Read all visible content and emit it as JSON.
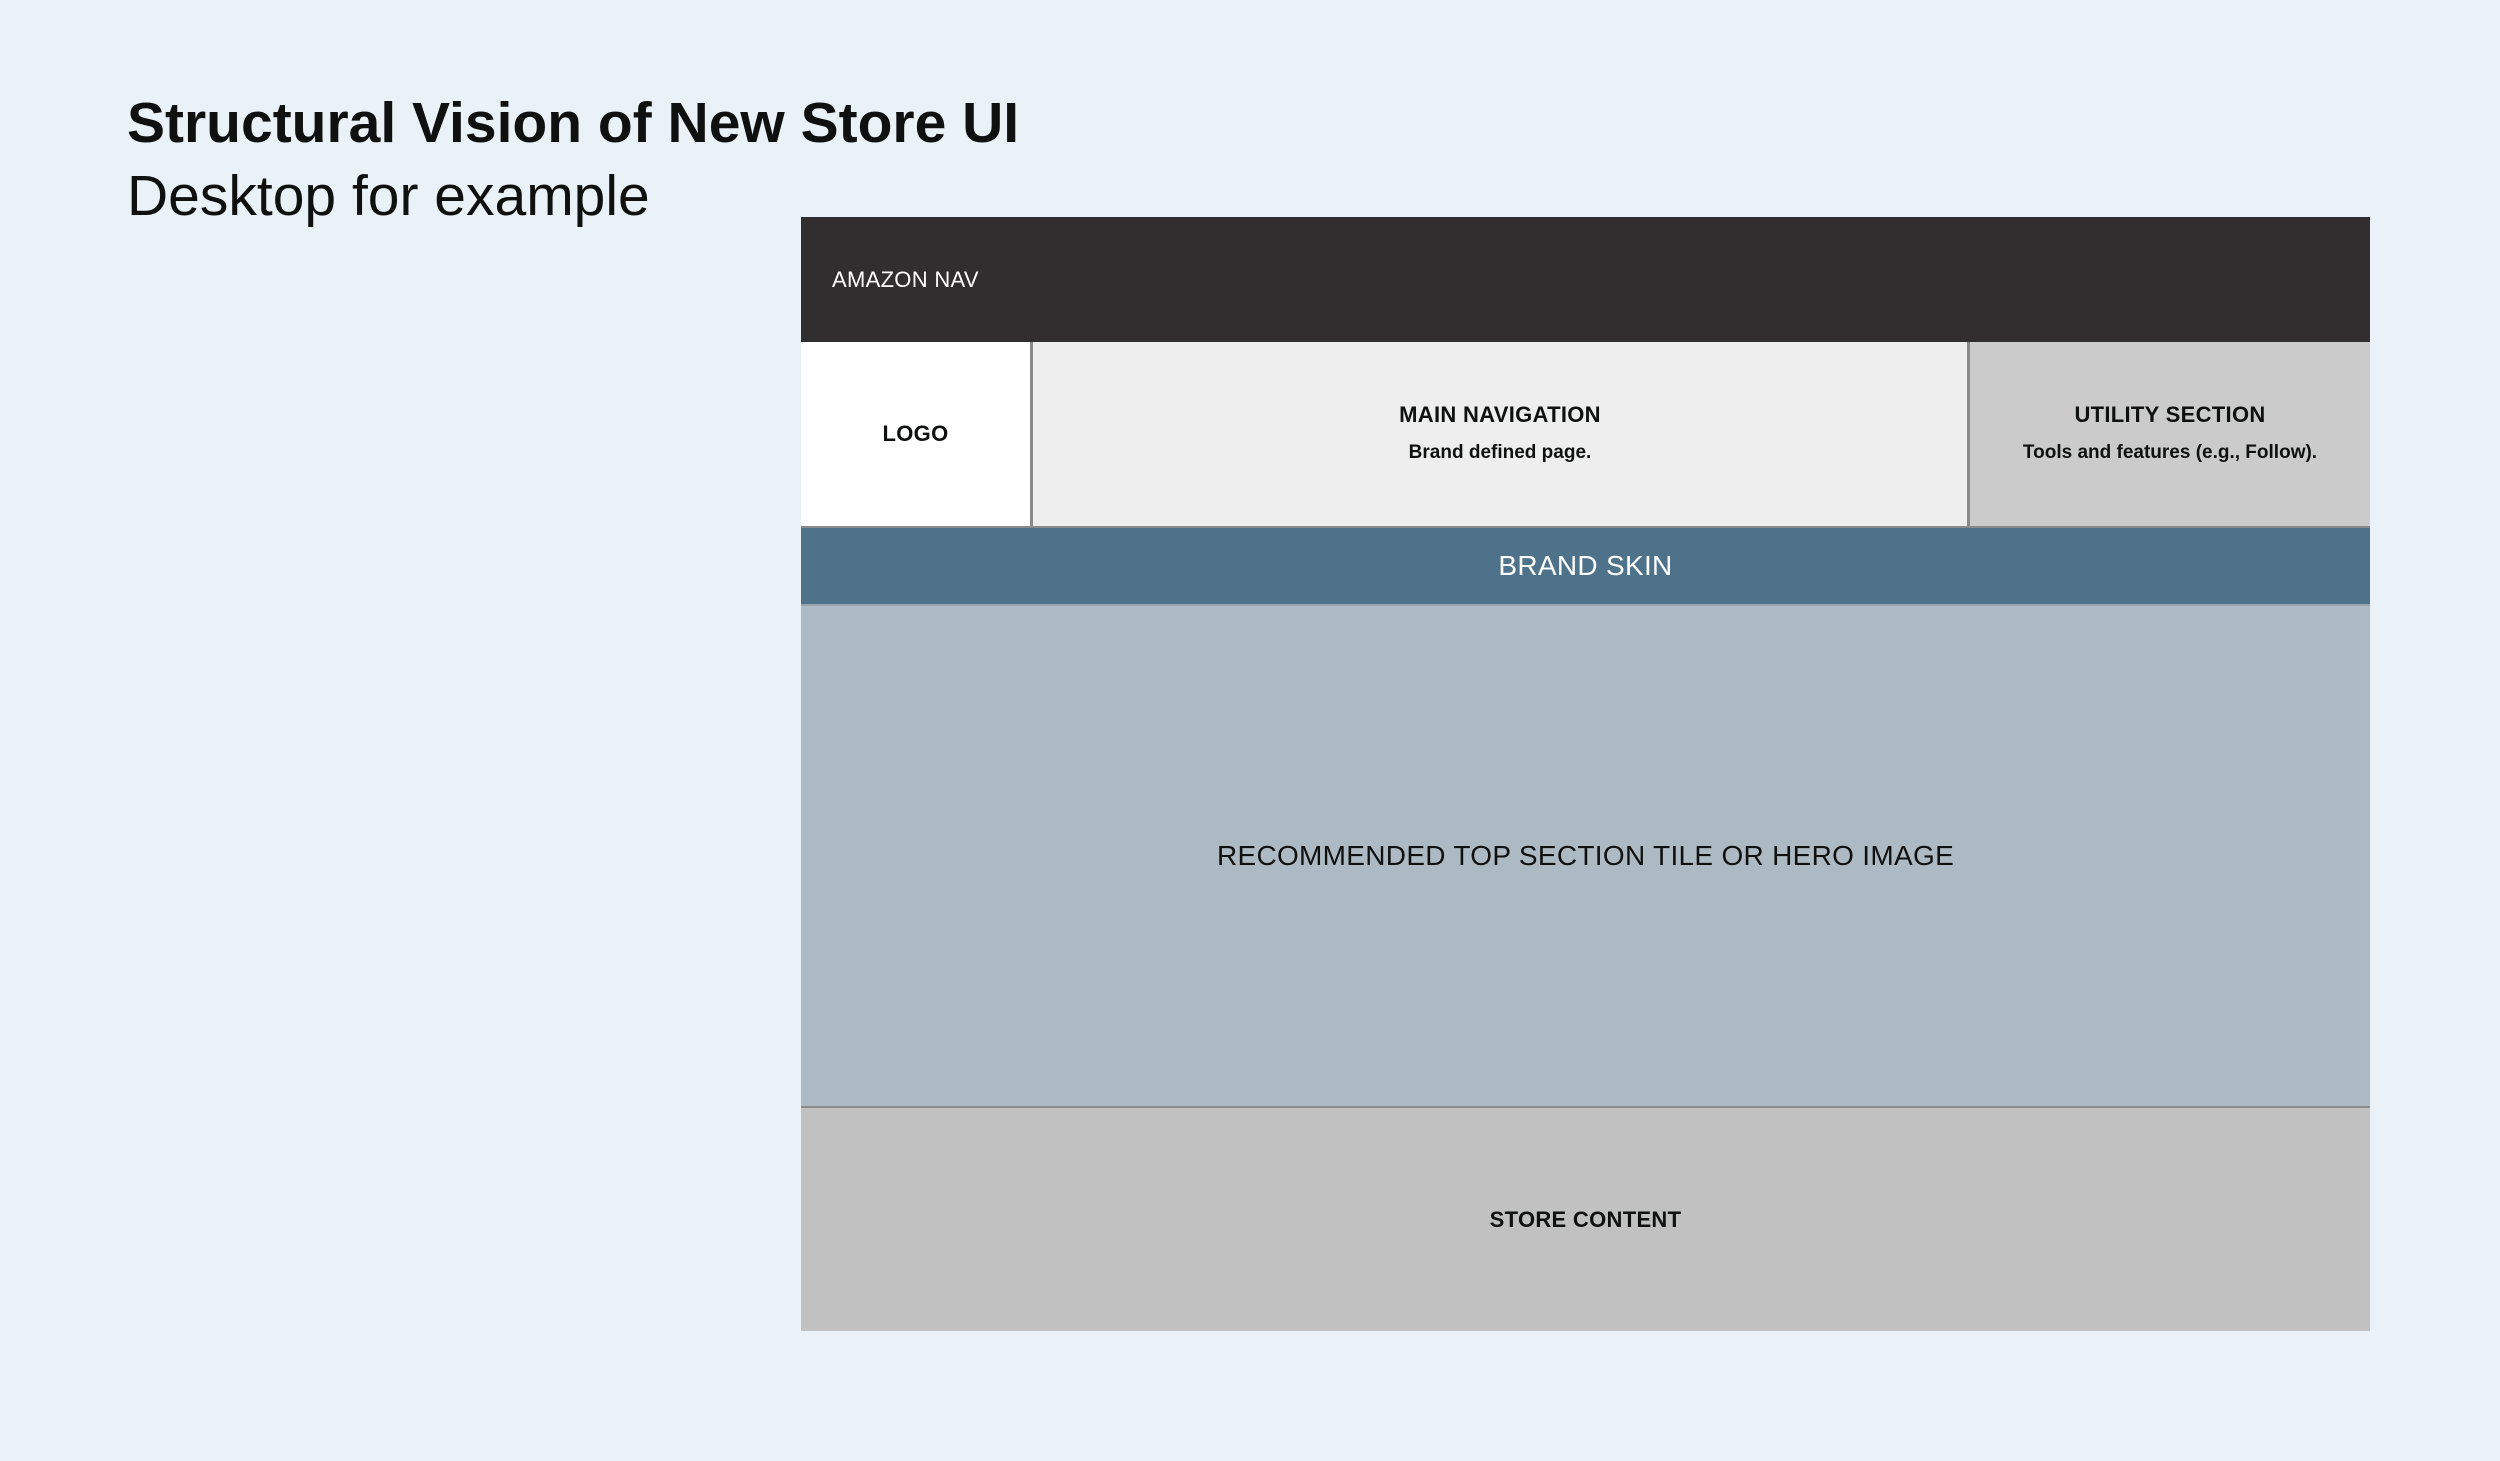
{
  "heading": {
    "title": "Structural Vision of New Store UI",
    "subtitle": "Desktop for example"
  },
  "wireframe": {
    "amazon_nav": "AMAZON NAV",
    "logo": "LOGO",
    "main_navigation": {
      "title": "MAIN NAVIGATION",
      "description": "Brand defined page."
    },
    "utility_section": {
      "title": "UTILITY SECTION",
      "description": "Tools and features (e.g., Follow)."
    },
    "brand_skin": "BRAND SKIN",
    "hero": "RECOMMENDED TOP SECTION TILE OR HERO IMAGE",
    "store_content": "STORE CONTENT"
  },
  "colors": {
    "page_background": "#eaf2f8",
    "amazon_nav": "#302e2f",
    "logo_cell": "#ffffff",
    "main_navigation_cell": "#eeeeee",
    "utility_cell": "#cbcbcb",
    "brand_skin": "#4f728b",
    "hero": "#adbac3",
    "store_content": "#c1c1c1"
  }
}
